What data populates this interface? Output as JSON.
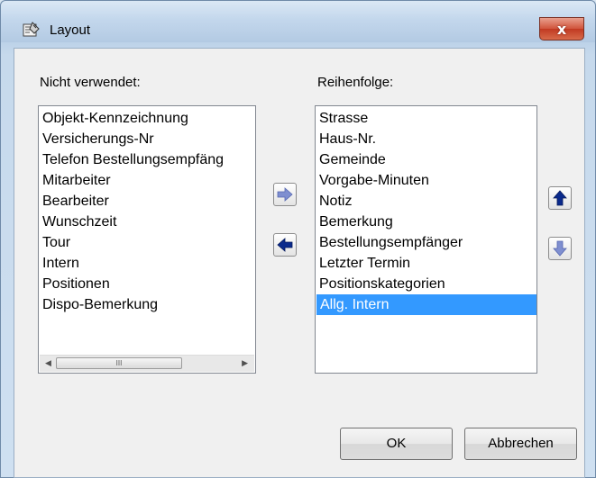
{
  "window": {
    "title": "Layout",
    "close_glyph": "x"
  },
  "left_list": {
    "label": "Nicht verwendet:",
    "items": [
      "Objekt-Kennzeichnung",
      "Versicherungs-Nr",
      "Telefon Bestellungsempfäng",
      "Mitarbeiter",
      "Bearbeiter",
      "Wunschzeit",
      "Tour",
      "Intern",
      "Positionen",
      "Dispo-Bemerkung"
    ],
    "scroll_thumb_grip": "III"
  },
  "right_list": {
    "label": "Reihenfolge:",
    "items": [
      "Strasse",
      "Haus-Nr.",
      "Gemeinde",
      "Vorgabe-Minuten",
      "Notiz",
      "Bemerkung",
      "Bestellungsempfänger",
      "Letzter Termin",
      "Positionskategorien",
      "Allg. Intern"
    ],
    "selected_item": "Allg. Intern"
  },
  "buttons": {
    "ok": "OK",
    "cancel": "Abbrechen"
  },
  "icons": {
    "move_right": "arrow-right-icon",
    "move_left": "arrow-left-icon",
    "move_up": "arrow-up-icon",
    "move_down": "arrow-down-icon"
  },
  "colors": {
    "selection": "#3399ff",
    "arrow_active": "#0a2a8c",
    "arrow_inactive": "#7f8fd0",
    "close_button": "#c13a22"
  }
}
